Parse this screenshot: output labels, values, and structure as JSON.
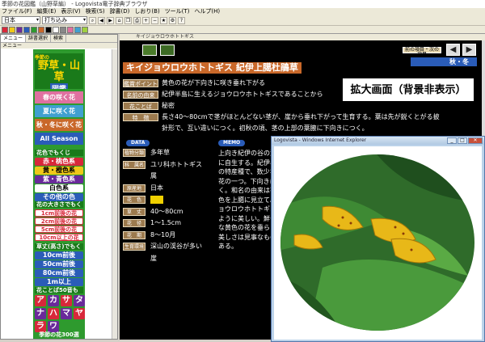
{
  "window": {
    "title": "季節の花図鑑（山野草編） - Logovista電子辞典ブラウザ"
  },
  "menu": [
    "ファイル(F)",
    "編集(E)",
    "表示(V)",
    "検索(S)",
    "辞書(D)",
    "しおり(B)",
    "ツール(T)",
    "ヘルプ(H)"
  ],
  "toolbar": {
    "dict_select": "日本",
    "search_select": "打ち込み"
  },
  "left": {
    "tabs": [
      "メニュー",
      "辞書選択",
      "検索"
    ],
    "section_title": "メニュー",
    "logo": {
      "top": "季節の",
      "main1": "野草",
      "main2": "山草",
      "sub": "図鑑"
    },
    "seasons": [
      "春の咲く花",
      "夏に咲く花",
      "秋・冬に咲く花",
      "All Season"
    ],
    "color_header": "花色でもくじ",
    "colors": [
      {
        "label": "赤・桃色系",
        "bg": "#d8283a",
        "fg": "#ffffff"
      },
      {
        "label": "黄・橙色系",
        "bg": "#f0c818",
        "fg": "#000000"
      },
      {
        "label": "紫・青色系",
        "bg": "#6a2a9a",
        "fg": "#ffffff"
      },
      {
        "label": "白色系",
        "bg": "#ffffff",
        "fg": "#000000"
      },
      {
        "label": "その他の色",
        "bg": "#2a5cb8",
        "fg": "#ffffff"
      }
    ],
    "flower_size_header": "花の大きさでもくじ",
    "flower_sizes": [
      "1cm前後の花",
      "2cm前後の花",
      "5cm前後の花",
      "10cm以上の花"
    ],
    "plant_height_header": "草丈(高さ)でもくじ",
    "plant_heights": [
      "10cm前後",
      "50cm前後",
      "80cm前後",
      "1m以上"
    ],
    "kana_header": "花ことば50音もくじ",
    "kana": [
      {
        "ch": "ア",
        "bg": "#d8283a"
      },
      {
        "ch": "カ",
        "bg": "#6a2a9a"
      },
      {
        "ch": "サ",
        "bg": "#d8283a"
      },
      {
        "ch": "タ",
        "bg": "#6a2a9a"
      },
      {
        "ch": "ナ",
        "bg": "#6a2a9a"
      },
      {
        "ch": "ハ",
        "bg": "#d8283a"
      },
      {
        "ch": "マ",
        "bg": "#6a2a9a"
      },
      {
        "ch": "ヤ",
        "bg": "#d8283a"
      },
      {
        "ch": "ラ",
        "bg": "#d8283a"
      },
      {
        "ch": "ワ",
        "bg": "#6a2a9a"
      }
    ],
    "footer": "季節の花300選"
  },
  "content": {
    "tab_label": "キイジョウロウホトトギス",
    "title": "キイジョウロウホトトギス 紀伊上臈杜鵑草",
    "nav_label": "前の項目・次の項目",
    "season": "秋・冬",
    "rows": [
      {
        "label": "鑑賞ポイント",
        "text": "黄色の花が下向きに咲き垂れ下がる"
      },
      {
        "label": "名前の由来",
        "text": "紀伊半島に生えるジョウロウホトトギスであることから"
      },
      {
        "label": "花ことば",
        "text": "秘密"
      },
      {
        "label": "特　徴",
        "text": "長さ40〜80cmで茎がほとんどない茎が、崖から垂れ下がって生育する。葉は先が鋭くとがる披"
      },
      {
        "label": "",
        "text": "針形で、互い違いにつく。初秋の頃、茎の上部の葉腋に下向きにつく。"
      }
    ],
    "data_header": "DATA",
    "data": [
      {
        "label": "植物分類",
        "value": "多年草"
      },
      {
        "label": "科　属名",
        "value": "ユリ科ホトトギス"
      },
      {
        "label": "",
        "value": "属"
      },
      {
        "label": "原産地",
        "value": "日本"
      },
      {
        "label": "花　色",
        "value": ""
      },
      {
        "label": "草　丈",
        "value": "40〜80cm"
      },
      {
        "label": "花　径",
        "value": "1〜1.5cm"
      },
      {
        "label": "花　期",
        "value": "8〜10月"
      },
      {
        "label": "生育環境",
        "value": "深山の渓谷が多い"
      },
      {
        "label": "",
        "value": "崖"
      }
    ],
    "flower_color_swatch": "#f0d000",
    "memo_header": "MEMO",
    "memo": "上向き紀伊の谷の渓谷に自生する。紀伊半島の特産種で、数少ない花の一つ。下向きに咲く。和名の由来は花の色を上臈に見立て、ジョウロウホトトギスのように美しい。鮮やかな黄色の花を垂らした美しさは見事なものである。",
    "callout": "拡大画面（背景非表示）"
  },
  "popup": {
    "title": "Logovista - Windows Internet Explorer"
  }
}
